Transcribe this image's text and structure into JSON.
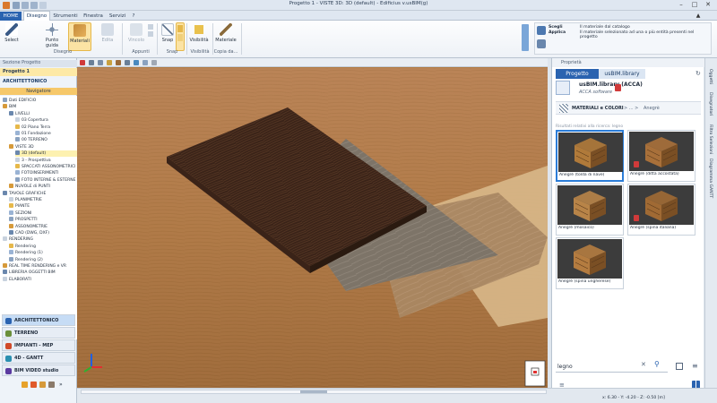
{
  "window": {
    "title": "Progetto 1 - VISTE 3D: 3D (default) - Edificius v.usBIM(g)"
  },
  "tabs": [
    {
      "label": "HOME"
    },
    {
      "label": "Disegno"
    },
    {
      "label": "Strumenti"
    },
    {
      "label": "Finestra"
    },
    {
      "label": "Servizi"
    },
    {
      "label": "?"
    }
  ],
  "ribbon": {
    "buttons": {
      "select": "Select",
      "punto_guida": "Punto guida",
      "materiali": "Materiali",
      "edita": "Edita",
      "vincolo": "Vincolo",
      "snap": "Snap",
      "visibilita": "Visibilità",
      "materiale": "Materiale"
    },
    "groups": {
      "disegno": "Disegno",
      "appunti": "Appunti",
      "snap": "Snap",
      "visibilita": "Visibilità",
      "copia_da": "Copia da..."
    },
    "info": {
      "scegli": "Scegli",
      "applica": "Applica",
      "line1": "Il materiale dal catalogo",
      "line2": "Il materiale selezionato ad una o più entità presenti nel progetto"
    }
  },
  "left_panel": {
    "header": "Sezione Progetto",
    "project": "Progetto 1",
    "section": "ARCHITETTONICO",
    "navigator": "Navigatore",
    "tree": [
      {
        "label": "Dati EDIFICIO",
        "indent": 0
      },
      {
        "label": "BIM",
        "indent": 0
      },
      {
        "label": "LIVELLI",
        "indent": 1
      },
      {
        "label": "03 Copertura",
        "indent": 2
      },
      {
        "label": "02 Piano Terra",
        "indent": 2
      },
      {
        "label": "01 Fondazione",
        "indent": 2
      },
      {
        "label": "00 TERRENO",
        "indent": 2
      },
      {
        "label": "VISTE 3D",
        "indent": 1
      },
      {
        "label": "3D (default)",
        "indent": 2,
        "highlight": true
      },
      {
        "label": "3 - Prospettiva",
        "indent": 2
      },
      {
        "label": "SPACCATI ASSONOMETRICI",
        "indent": 2
      },
      {
        "label": "FOTOINSERIMENTI",
        "indent": 2
      },
      {
        "label": "FOTO INTERNE & ESTERNE",
        "indent": 2
      },
      {
        "label": "NUVOLE di PUNTI",
        "indent": 1
      },
      {
        "label": "TAVOLE GRAFICHE",
        "indent": 0
      },
      {
        "label": "PLANIMETRIE",
        "indent": 1
      },
      {
        "label": "PIANTE",
        "indent": 1
      },
      {
        "label": "SEZIONI",
        "indent": 1
      },
      {
        "label": "PROSPETTI",
        "indent": 1
      },
      {
        "label": "ASSONOMETRIE",
        "indent": 1
      },
      {
        "label": "CAD (DWG, DXF)",
        "indent": 1
      },
      {
        "label": "RENDERING",
        "indent": 0
      },
      {
        "label": "Rendering",
        "indent": 1
      },
      {
        "label": "Rendering (1)",
        "indent": 1
      },
      {
        "label": "Rendering (2)",
        "indent": 1
      },
      {
        "label": "REAL TIME RENDERING e VR",
        "indent": 0
      },
      {
        "label": "LIBRERIA OGGETTI BIM",
        "indent": 0
      },
      {
        "label": "ELABORATI",
        "indent": 0
      }
    ],
    "nav_buttons": [
      {
        "label": "ARCHITETTONICO",
        "selected": true,
        "color": "#2a63b0"
      },
      {
        "label": "TERRENO",
        "selected": false,
        "color": "#6a8f3a"
      },
      {
        "label": "IMPIANTI - MEP",
        "selected": false,
        "color": "#d04a2a"
      },
      {
        "label": "4D - GANTT",
        "selected": false,
        "color": "#2a8fb0"
      },
      {
        "label": "BIM VIDEO studio",
        "selected": false,
        "color": "#5a3aa0"
      }
    ]
  },
  "right_panel": {
    "header": "Proprietà",
    "tabs": [
      "Progetto",
      "usBIM.library"
    ],
    "library_title": "usBIM.library (ACCA)",
    "library_sub": "ACCA software",
    "breadcrumb": {
      "root": "MATERIALI e COLORI",
      "sep": "> ... >",
      "leaf": "Anegrè"
    },
    "results_label": "Risultati relativi alla ricerca:",
    "results_term": "legno",
    "materials": [
      {
        "name": "Anegrè (tolda di nave)",
        "selected": true,
        "locked": false
      },
      {
        "name": "Anegrè (ditta accostata)",
        "selected": false,
        "locked": true
      },
      {
        "name": "Anegrè (mosaico)",
        "selected": false,
        "locked": false
      },
      {
        "name": "Anegrè (spina italiana)",
        "selected": false,
        "locked": true
      },
      {
        "name": "Anegrè (spina ungherese)",
        "selected": false,
        "locked": false
      }
    ],
    "search": {
      "value": "legno"
    }
  },
  "side_strip": [
    "Oggetti",
    "Disegnatori",
    "Filtro Selezioni",
    "Diagramma GANTT"
  ],
  "status": {
    "coords": "x: 6.30 - Y: -4.20 - Z: -0.50 [m]"
  },
  "colors": {
    "accent": "#2a63b0",
    "selected": "#2b7dd8",
    "floor": "#b07a42"
  }
}
